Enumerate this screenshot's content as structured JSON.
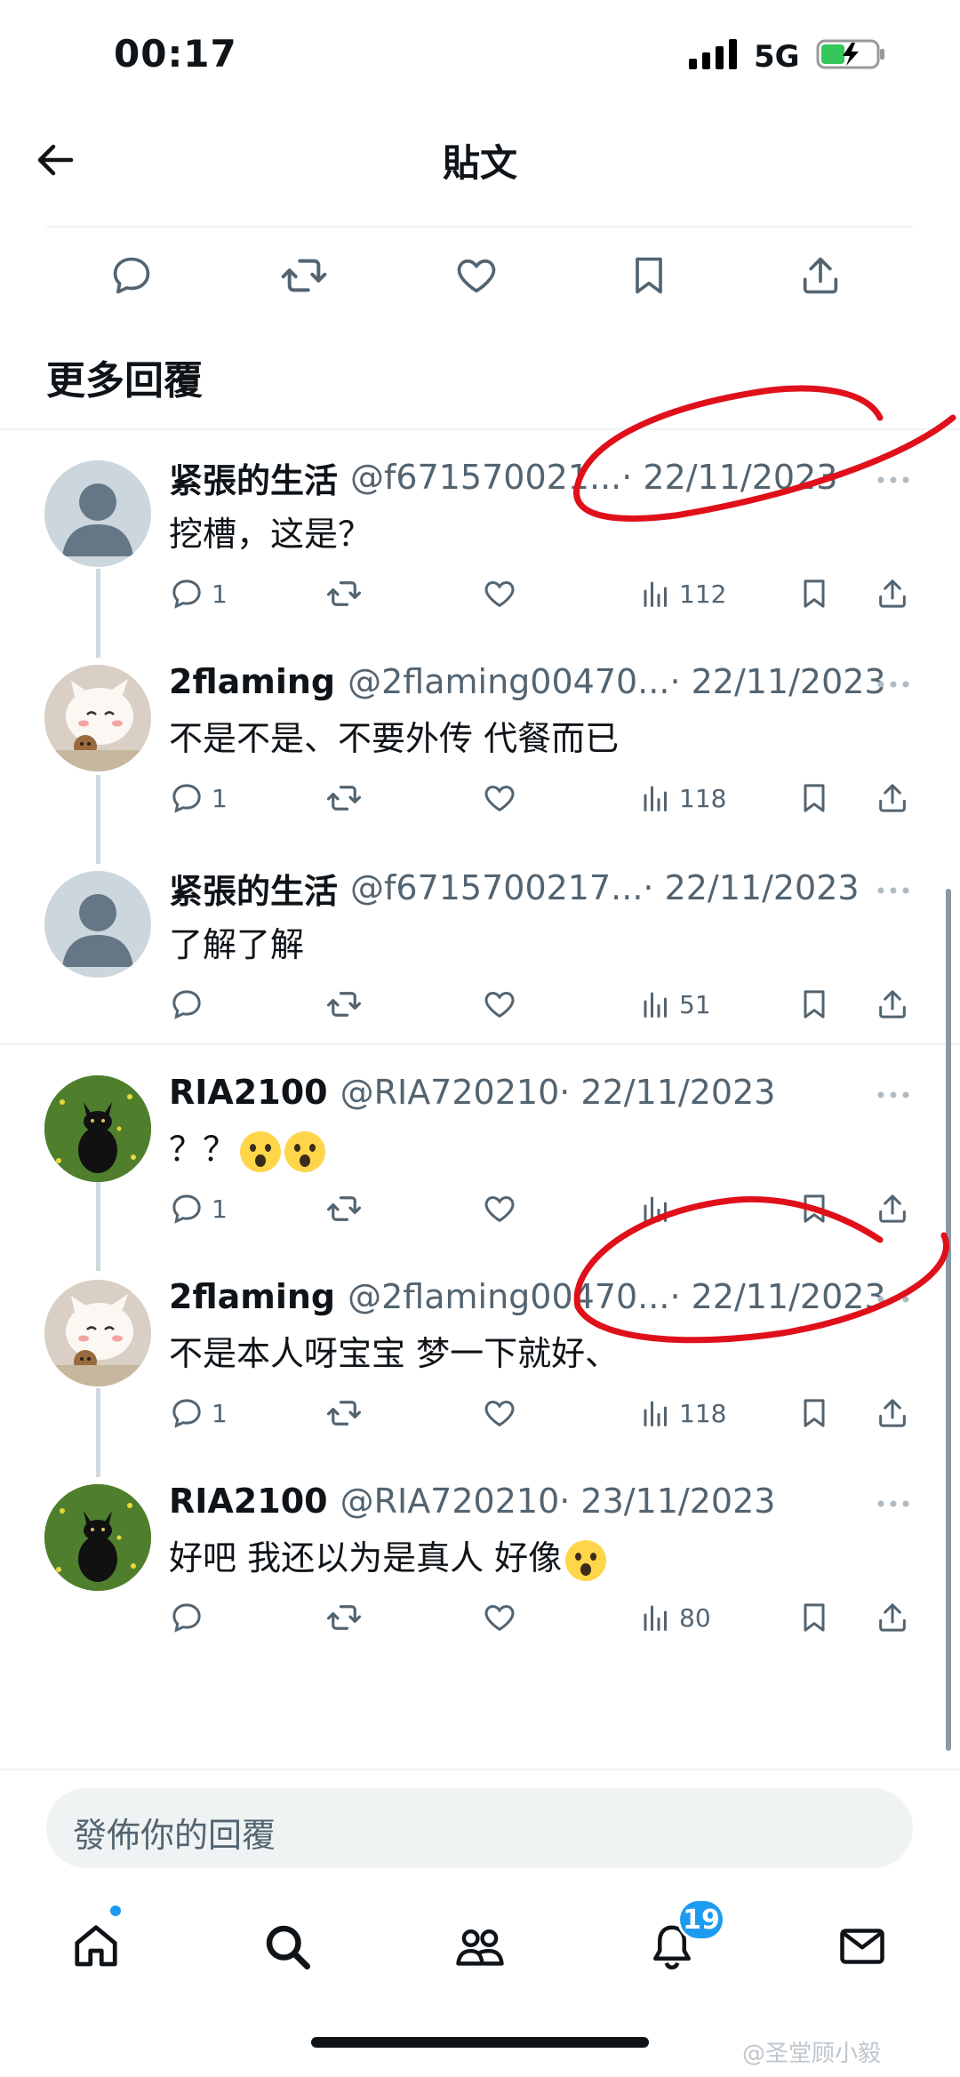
{
  "status_bar": {
    "time": "00:17",
    "network": "5G"
  },
  "header": {
    "title": "貼文"
  },
  "section_title": "更多回覆",
  "replies": [
    {
      "name": "紧張的生活",
      "handle": "@f671570021...",
      "date": "· 22/11/2023",
      "text": "挖槽，这是？",
      "replies": "1",
      "views": "112",
      "avatar": "default"
    },
    {
      "name": "2flaming",
      "handle": "@2flaming00470...",
      "date": "· 22/11/2023",
      "text": "不是不是、不要外传 代餐而已",
      "replies": "1",
      "views": "118",
      "avatar": "cat-cartoon"
    },
    {
      "name": "紧張的生活",
      "handle": "@f6715700217...",
      "date": "· 22/11/2023",
      "text": "了解了解",
      "replies": "",
      "views": "51",
      "avatar": "default"
    },
    {
      "name": "RIA2100",
      "handle": "@RIA720210",
      "date": "· 22/11/2023",
      "text": "？？",
      "emoji_count": 2,
      "replies": "1",
      "views": "",
      "avatar": "black-cat"
    },
    {
      "name": "2flaming",
      "handle": "@2flaming00470...",
      "date": "· 22/11/2023",
      "text": "不是本人呀宝宝 梦一下就好、",
      "replies": "1",
      "views": "118",
      "avatar": "cat-cartoon"
    },
    {
      "name": "RIA2100",
      "handle": "@RIA720210",
      "date": "· 23/11/2023",
      "text": "好吧 我还以为是真人 好像",
      "emoji_count": 1,
      "replies": "",
      "views": "80",
      "avatar": "black-cat"
    }
  ],
  "compose": {
    "placeholder": "發佈你的回覆"
  },
  "bottom_nav": {
    "notifications_badge": "19"
  },
  "watermark": "@圣堂顾小毅",
  "colors": {
    "text_primary": "#0f1419",
    "text_secondary": "#536471",
    "accent": "#1d9bf0",
    "annotation": "#e0101a"
  }
}
